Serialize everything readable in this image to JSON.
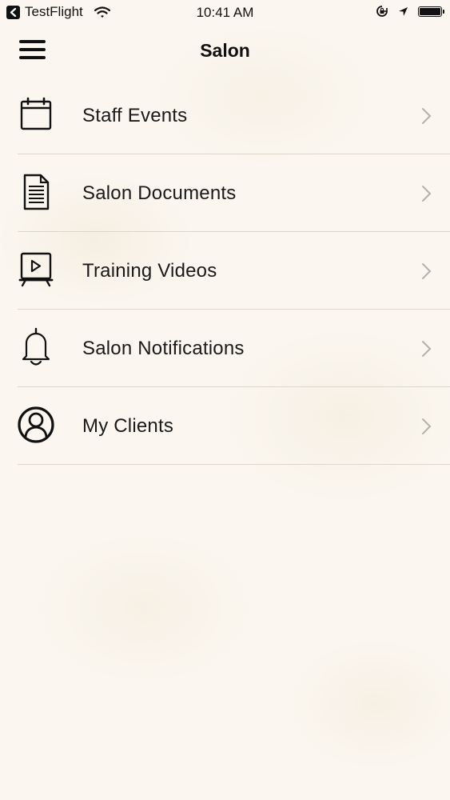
{
  "status_bar": {
    "back_app": "TestFlight",
    "time": "10:41 AM",
    "icons": [
      "back-icon",
      "wifi-icon",
      "orientation-lock-icon",
      "location-icon",
      "battery-icon"
    ]
  },
  "nav": {
    "title": "Salon",
    "menu_icon": "hamburger-menu-icon"
  },
  "menu": {
    "items": [
      {
        "label": "Staff Events",
        "icon": "calendar-icon"
      },
      {
        "label": "Salon Documents",
        "icon": "document-icon"
      },
      {
        "label": "Training Videos",
        "icon": "video-presentation-icon"
      },
      {
        "label": "Salon Notifications",
        "icon": "bell-icon"
      },
      {
        "label": "My Clients",
        "icon": "user-icon"
      }
    ]
  },
  "colors": {
    "background": "#fbf7f0",
    "divider": "#dcd6cd",
    "chevron": "#b5b0a8",
    "text": "#1a1a1a"
  }
}
